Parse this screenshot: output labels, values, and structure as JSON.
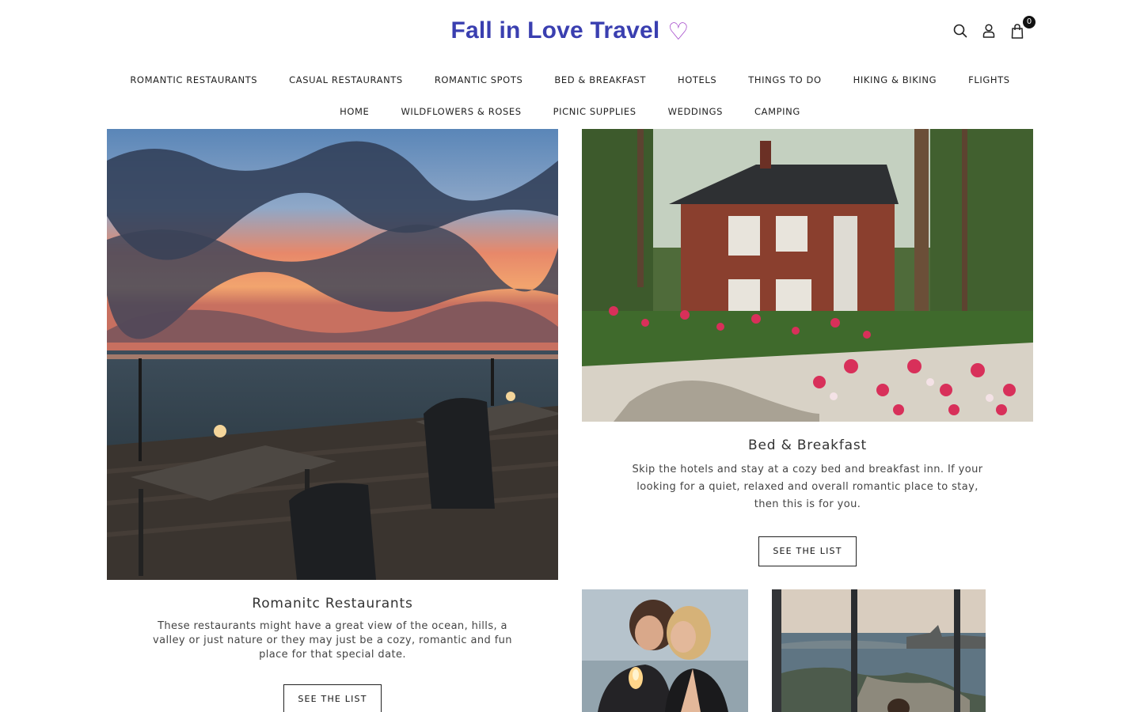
{
  "header": {
    "logo_text": "Fall in Love Travel",
    "logo_heart": "♡",
    "icons": [
      "search-icon",
      "user-icon",
      "cart-icon"
    ],
    "cart_count": "0",
    "brand_color": "#3a3fb0",
    "heart_color": "#a040c8"
  },
  "nav": {
    "row1": [
      "ROMANTIC RESTAURANTS",
      "CASUAL RESTAURANTS",
      "ROMANTIC SPOTS",
      "BED & BREAKFAST",
      "HOTELS",
      "THINGS TO DO",
      "HIKING & BIKING",
      "FLIGHTS"
    ],
    "row2": [
      "HOME",
      "WILDFLOWERS & ROSES",
      "PICNIC SUPPLIES",
      "WEDDINGS",
      "CAMPING"
    ]
  },
  "cards": [
    {
      "title": "Romanitc Restaurants",
      "text": "These restaurants might have a great view of the ocean, hills, a valley or just nature or they may just be a cozy, romantic and fun place for that special date.",
      "button": "SEE THE LIST",
      "image": "sunset-ocean-dining-deck"
    },
    {
      "title": "Bed & Breakfast",
      "text": "Skip the hotels and stay at a cozy bed and breakfast inn. If your looking for a quiet, relaxed and overall romantic place to stay, then this is for you.",
      "button": "SEE THE LIST",
      "image": "brick-house-with-rose-garden"
    },
    {
      "image": "couple-kissing-candle"
    },
    {
      "image": "window-view-city-bay"
    }
  ]
}
